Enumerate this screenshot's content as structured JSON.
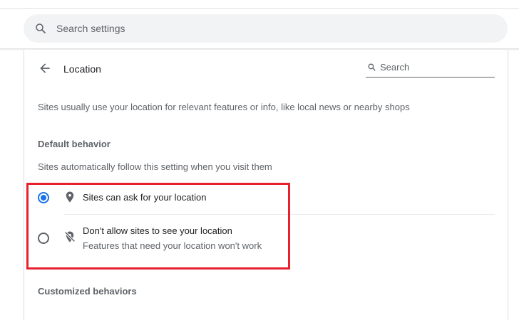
{
  "search_settings": {
    "placeholder": "Search settings"
  },
  "header": {
    "title": "Location",
    "search_placeholder": "Search"
  },
  "description": "Sites usually use your location for relevant features or info, like local news or nearby shops",
  "default_behavior": {
    "heading": "Default behavior",
    "subtext": "Sites automatically follow this setting when you visit them",
    "options": [
      {
        "label": "Sites can ask for your location",
        "icon": "location-pin-icon",
        "selected": true
      },
      {
        "label": "Don't allow sites to see your location",
        "sublabel": "Features that need your location won't work",
        "icon": "location-off-icon",
        "selected": false
      }
    ]
  },
  "customized_behaviors": {
    "heading": "Customized behaviors"
  },
  "colors": {
    "accent": "#1a73e8",
    "highlight": "#e8202e",
    "text_primary": "#202124",
    "text_secondary": "#5f6368"
  }
}
